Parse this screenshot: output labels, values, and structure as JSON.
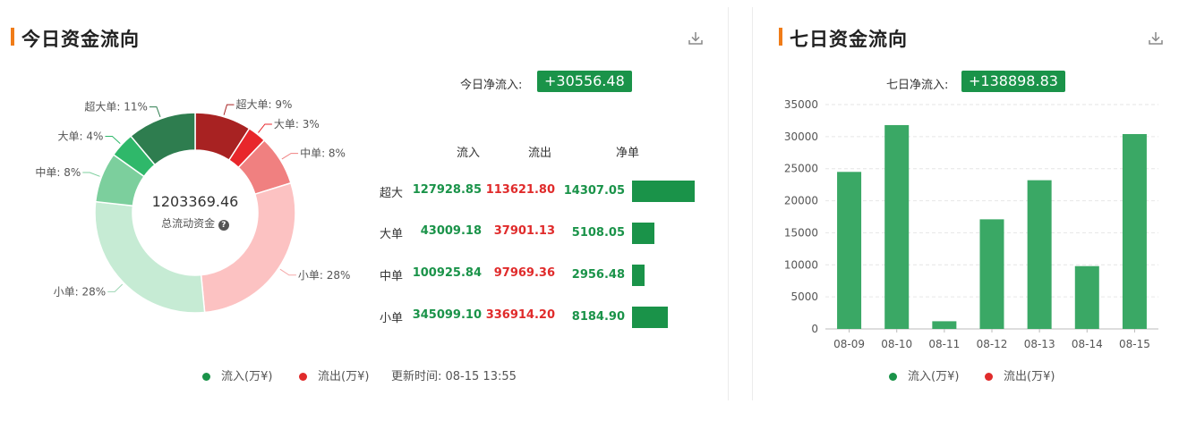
{
  "left": {
    "title": "今日资金流向",
    "net_label": "今日净流入:",
    "net_value": "+30556.48",
    "donut": {
      "center_value": "1203369.46",
      "center_label": "总流动资金",
      "help_icon": "question-circle-icon"
    },
    "table": {
      "headers": [
        "流入",
        "流出",
        "净单"
      ],
      "rows": [
        {
          "label": "超大",
          "in": "127928.85",
          "out": "113621.80",
          "net": "14307.05"
        },
        {
          "label": "大单",
          "in": "43009.18",
          "out": "37901.13",
          "net": "5108.05"
        },
        {
          "label": "中单",
          "in": "100925.84",
          "out": "97969.36",
          "net": "2956.48"
        },
        {
          "label": "小单",
          "in": "345099.10",
          "out": "336914.20",
          "net": "8184.90"
        }
      ]
    },
    "legend": {
      "inflow": "流入(万¥)",
      "outflow": "流出(万¥)",
      "update": "更新时间: 08-15 13:55"
    }
  },
  "right": {
    "title": "七日资金流向",
    "net_label": "七日净流入:",
    "net_value": "+138898.83",
    "legend": {
      "inflow": "流入(万¥)",
      "outflow": "流出(万¥)"
    }
  },
  "colors": {
    "green": "#1a9349",
    "red": "#e02b2b",
    "accent": "#f07c18",
    "bar": "#3aa865"
  },
  "chart_data": [
    {
      "type": "pie",
      "variant": "donut",
      "slices": [
        {
          "label": "超大单: 9%",
          "value": 9,
          "color": "#a82222",
          "group": "out"
        },
        {
          "label": "大单: 3%",
          "value": 3,
          "color": "#e8262b",
          "group": "out"
        },
        {
          "label": "中单: 8%",
          "value": 8,
          "color": "#f08080",
          "group": "out"
        },
        {
          "label": "小单: 28%",
          "value": 28,
          "color": "#fcc2c2",
          "group": "out"
        },
        {
          "label": "小单: 28%",
          "value": 28,
          "color": "#c6ebd4",
          "group": "in"
        },
        {
          "label": "中单: 8%",
          "value": 8,
          "color": "#7ccf9d",
          "group": "in"
        },
        {
          "label": "大单: 4%",
          "value": 4,
          "color": "#2fb86a",
          "group": "in"
        },
        {
          "label": "超大单: 11%",
          "value": 11,
          "color": "#2e7d4f",
          "group": "in"
        }
      ]
    },
    {
      "type": "bar",
      "categories": [
        "08-09",
        "08-10",
        "08-11",
        "08-12",
        "08-13",
        "08-14",
        "08-15"
      ],
      "values": [
        24500,
        31800,
        1200,
        17100,
        23200,
        9800,
        30400
      ],
      "ylim": [
        0,
        35000
      ],
      "yticks": [
        "0",
        "5000",
        "10000",
        "15000",
        "20000",
        "25000",
        "30000",
        "35000"
      ],
      "grid": true
    },
    {
      "type": "bar",
      "orientation": "horizontal",
      "categories": [
        "超大",
        "大单",
        "中单",
        "小单"
      ],
      "values": [
        14307.05,
        5108.05,
        2956.48,
        8184.9
      ]
    }
  ]
}
